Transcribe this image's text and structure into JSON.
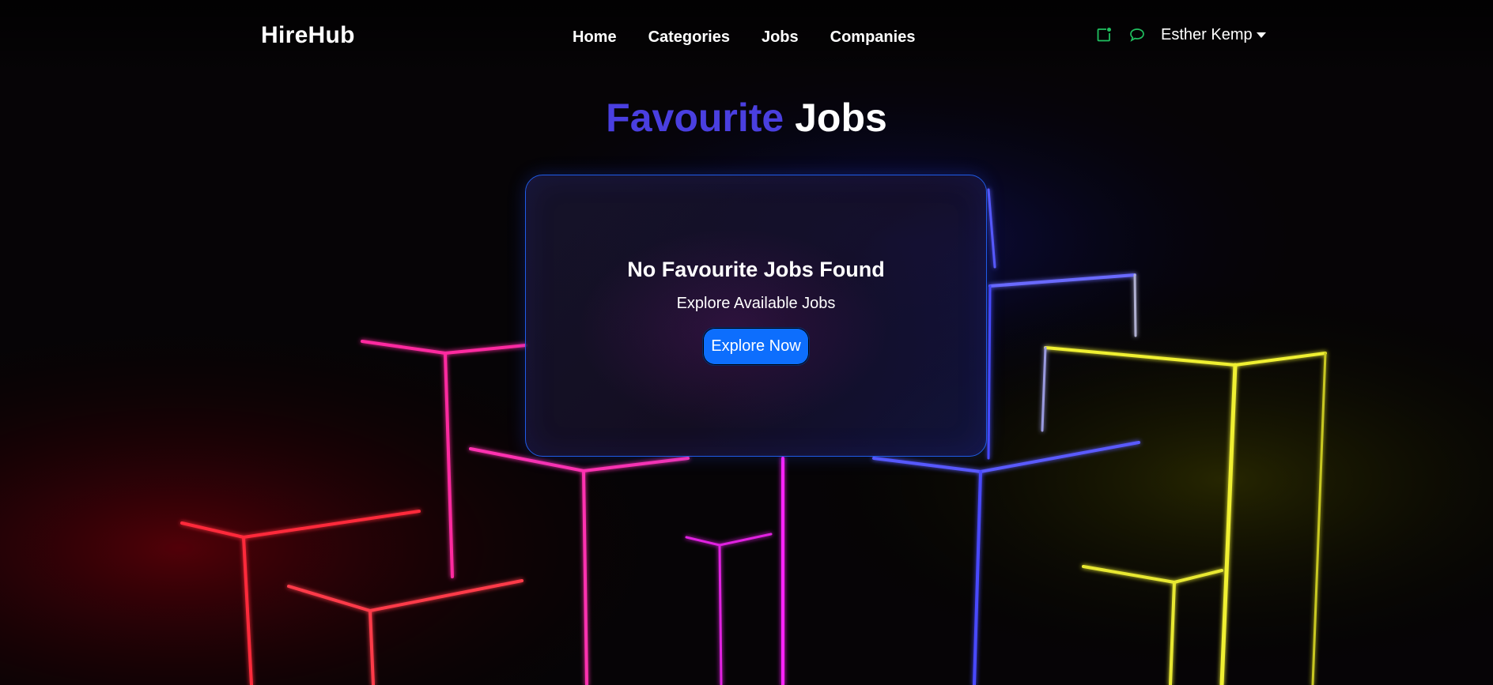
{
  "brand": {
    "name": "HireHub"
  },
  "nav": {
    "items": [
      {
        "label": "Home"
      },
      {
        "label": "Categories"
      },
      {
        "label": "Jobs"
      },
      {
        "label": "Companies"
      }
    ]
  },
  "user": {
    "name": "Esther Kemp",
    "icons": [
      "notification-icon",
      "chat-icon"
    ]
  },
  "page": {
    "title_accent": "Favourite",
    "title_rest": "Jobs"
  },
  "empty_state": {
    "heading": "No Favourite Jobs Found",
    "subtext": "Explore Available Jobs",
    "button_label": "Explore Now"
  },
  "colors": {
    "accent": "#4a3fe0",
    "button": "#0d6efd",
    "card_border": "#1f5ce8",
    "icon_green": "#20c060"
  }
}
